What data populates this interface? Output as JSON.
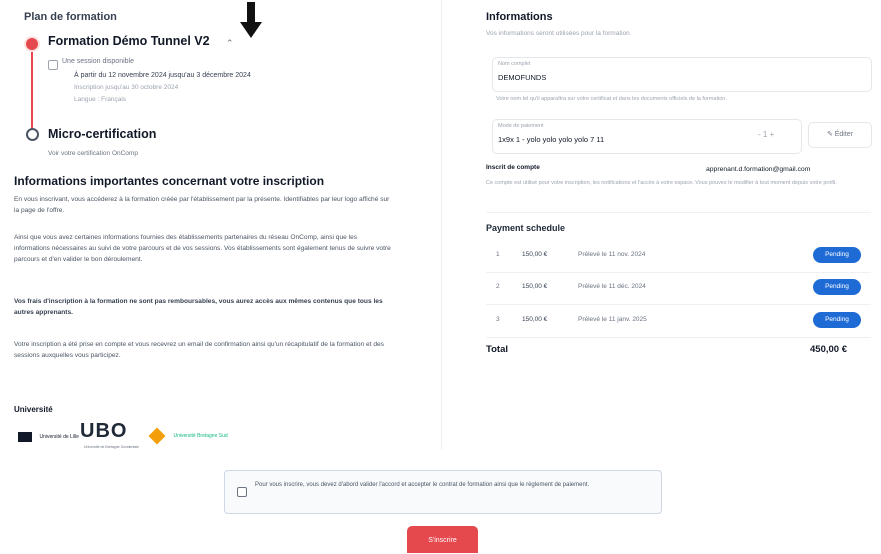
{
  "left": {
    "plan_heading": "Plan de formation",
    "formation_title": "Formation Démo Tunnel V2",
    "session_line": "Une session disponible",
    "session_dates": "À partir du 12 novembre 2024 jusqu'au 3 décembre 2024",
    "session_sub": "Inscription jusqu'au 30 octobre 2024",
    "session_language": "Langue : Français",
    "micro_title": "Micro-certification",
    "micro_sub": "Voir votre certification OnComp",
    "info_heading": "Informations importantes concernant votre inscription",
    "paragraphs": [
      "En vous inscrivant, vous accéderez à la formation créée par l'établissement par la présente. Identifiables par leur logo affiché sur la page de l'offre.",
      "Ainsi que vous avez certaines informations fournies des établissements partenaires du réseau OnComp, ainsi que les informations nécessaires au suivi de votre parcours et de vos sessions. Vos établissements sont également tenus de suivre votre parcours et d'en valider le bon déroulement.",
      "Vos frais d'inscription à la formation ne sont pas remboursables, vous aurez accès aux mêmes contenus que tous les autres apprenants.",
      "Votre inscription a été prise en compte et vous recevrez un email de confirmation ainsi qu'un récapitulatif de la formation et des sessions auxquelles vous participez."
    ],
    "university_label": "Université",
    "logos": {
      "logo1_text": "Université de Lille",
      "ubo": "UBO",
      "ubo_sub": "Université de Bretagne Occidentale",
      "logo3_text": "Université Bretagne Sud"
    }
  },
  "right": {
    "heading": "Informations",
    "subheading": "Vos informations seront utilisées pour la formation",
    "field1_label": "Nom complet",
    "field1_value": "DEMOFUNDS",
    "field1_help": "Votre nom tel qu'il apparaîtra sur votre certificat et dans les documents officiels de la formation.",
    "field2_label": "Mode de paiement",
    "field2_value": "1x9x 1 - yolo yolo yolo yolo 7 11",
    "stepper": "- 1 +",
    "edit_label": "Éditer",
    "account_label": "Inscrit de compte",
    "account_email": "apprenant.d.formation@gmail.com",
    "account_help": "Ce compte est utilisé pour votre inscription, les notifications et l'accès à votre espace. Vous pouvez le modifier à tout moment depuis votre profil.",
    "payment_heading": "Payment schedule",
    "payments": [
      {
        "num": "1",
        "amount": "150,00 €",
        "date": "Prélevé le 11 nov. 2024",
        "status": "Pending"
      },
      {
        "num": "2",
        "amount": "150,00 €",
        "date": "Prélevé le 11 déc. 2024",
        "status": "Pending"
      },
      {
        "num": "3",
        "amount": "150,00 €",
        "date": "Prélevé le 11 janv. 2025",
        "status": "Pending"
      }
    ],
    "total_label": "Total",
    "total_value": "450,00 €"
  },
  "consent_text": "Pour vous inscrire, vous devez d'abord valider l'accord et accepter le contrat de formation ainsi que le règlement de paiement.",
  "submit_label": "S'inscrire",
  "colors": {
    "accent_red": "#e5484d",
    "pending_blue": "#1e6bd6"
  }
}
